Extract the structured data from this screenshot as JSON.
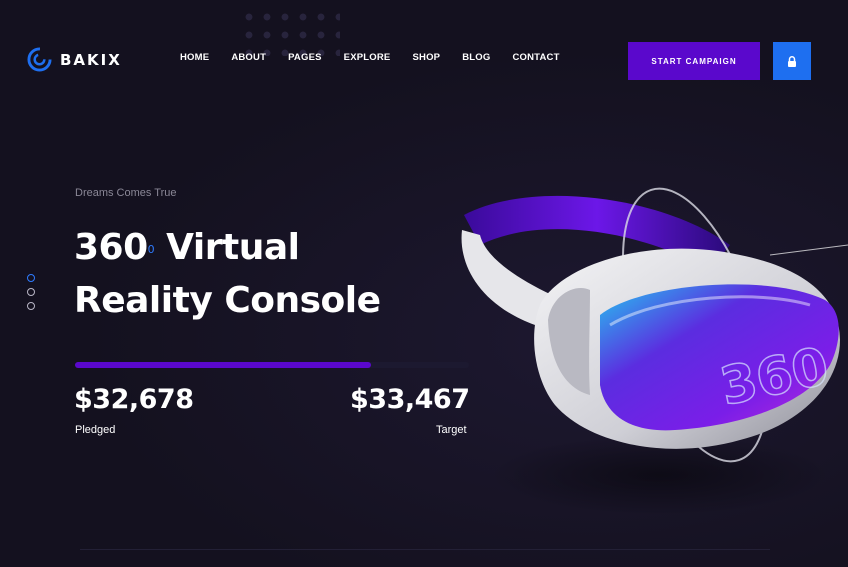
{
  "brand": {
    "name": "BAKIX",
    "accent": "#5a08cc",
    "blue": "#1e6ff0"
  },
  "nav": {
    "items": [
      {
        "label": "HOME"
      },
      {
        "label": "ABOUT"
      },
      {
        "label": "PAGES"
      },
      {
        "label": "EXPLORE"
      },
      {
        "label": "SHOP"
      },
      {
        "label": "BLOG"
      },
      {
        "label": "CONTACT"
      }
    ]
  },
  "header": {
    "cta_label": "START CAMPAIGN",
    "lock_icon": "lock-icon"
  },
  "hero": {
    "subtitle": "Dreams Comes True",
    "title_number": "360",
    "title_sup": "0",
    "title_rest_line1": "Virtual",
    "title_line2": "Reality Console",
    "progress_percent": 75,
    "pledged_value": "$32,678",
    "pledged_label": "Pledged",
    "target_value": "$33,467",
    "target_label": "Target"
  },
  "slider": {
    "count": 3,
    "active_index": 0
  },
  "illustration": {
    "text": "360"
  }
}
